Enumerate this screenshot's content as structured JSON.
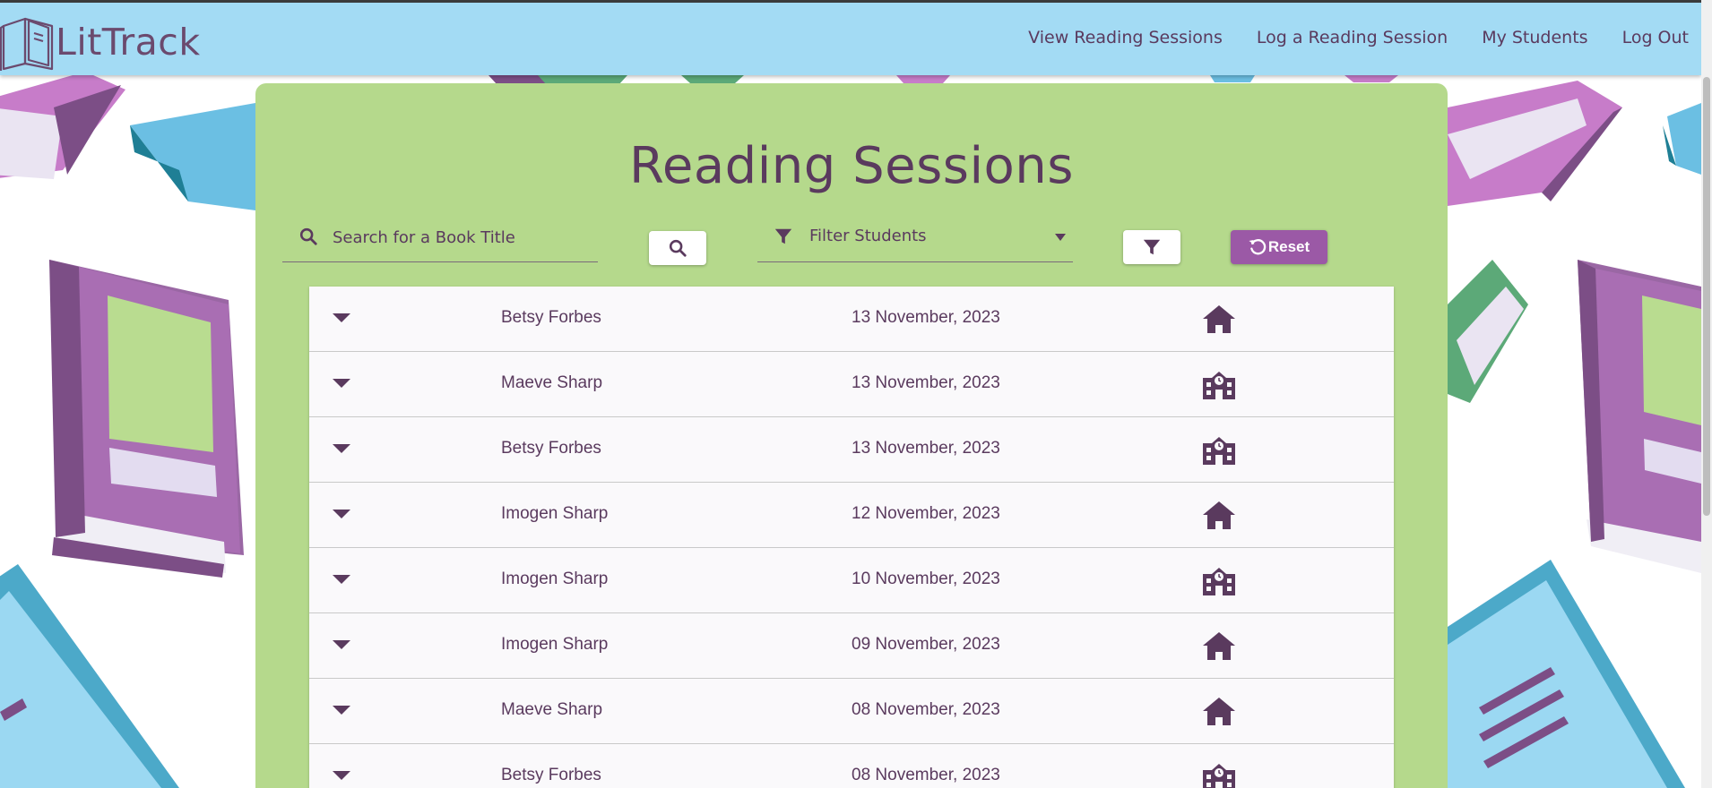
{
  "app": {
    "name": "LitTrack",
    "logo_icon": "open-book-logo-icon"
  },
  "nav": {
    "items": [
      {
        "label": "View Reading Sessions"
      },
      {
        "label": "Log a Reading Session"
      },
      {
        "label": "My Students"
      },
      {
        "label": "Log Out"
      }
    ]
  },
  "page": {
    "title": "Reading Sessions"
  },
  "search": {
    "placeholder": "Search for a Book Title",
    "value": "",
    "icon": "search-icon",
    "button_icon": "search-icon"
  },
  "filter": {
    "label": "Filter Students",
    "icon": "filter-icon",
    "button_icon": "filter-icon"
  },
  "reset": {
    "label": "Reset",
    "icon": "reset-icon"
  },
  "sessions": [
    {
      "student": "Betsy Forbes",
      "date": "13 November, 2023",
      "location": "home"
    },
    {
      "student": "Maeve Sharp",
      "date": "13 November, 2023",
      "location": "school"
    },
    {
      "student": "Betsy Forbes",
      "date": "13 November, 2023",
      "location": "school"
    },
    {
      "student": "Imogen Sharp",
      "date": "12 November, 2023",
      "location": "home"
    },
    {
      "student": "Imogen Sharp",
      "date": "10 November, 2023",
      "location": "school"
    },
    {
      "student": "Imogen Sharp",
      "date": "09 November, 2023",
      "location": "home"
    },
    {
      "student": "Maeve Sharp",
      "date": "08 November, 2023",
      "location": "home"
    },
    {
      "student": "Betsy Forbes",
      "date": "08 November, 2023",
      "location": "school"
    }
  ],
  "colors": {
    "navbar": "#a3dbf4",
    "panel": "#b5d98c",
    "text": "#5a3a5e",
    "accent": "#9b59a6",
    "icon": "#5a3a5e"
  }
}
